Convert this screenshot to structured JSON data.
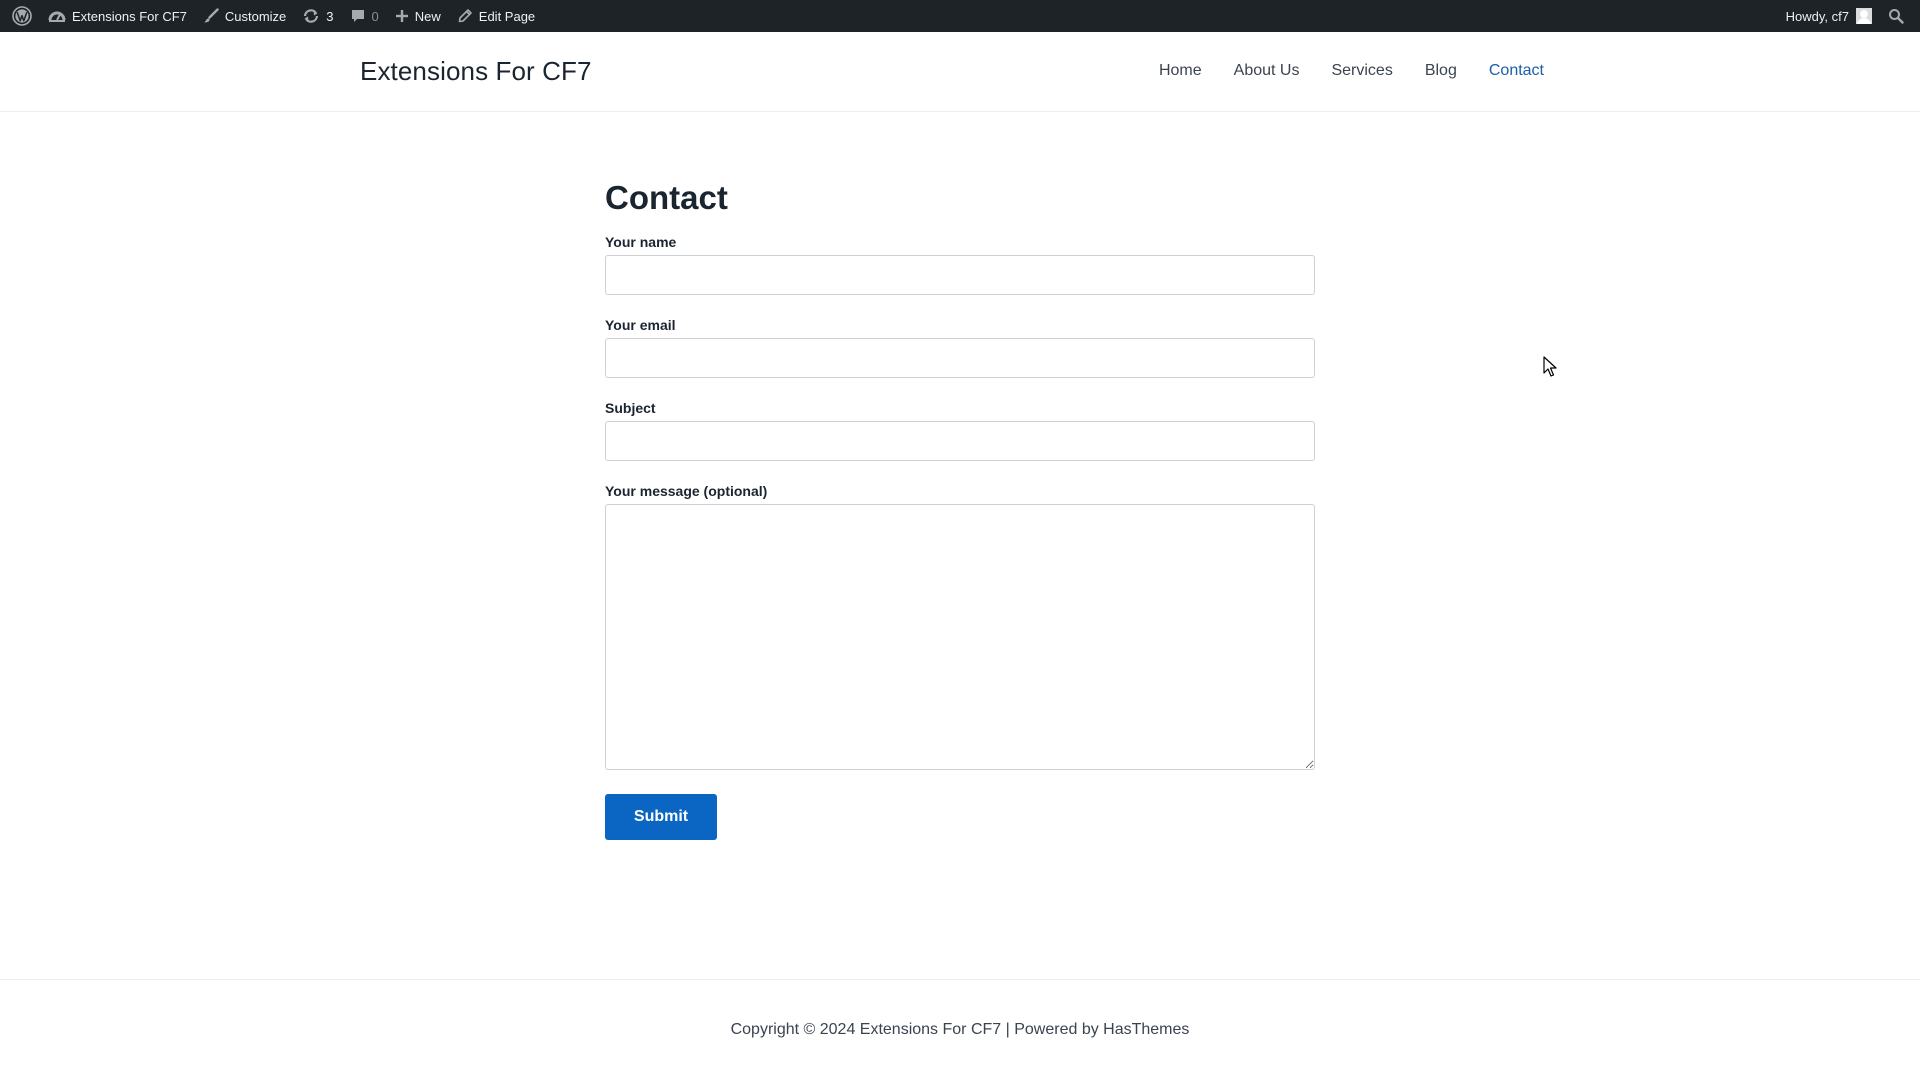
{
  "admin_bar": {
    "site_name": "Extensions For CF7",
    "customize_label": "Customize",
    "updates_count": "3",
    "comments_count": "0",
    "new_label": "New",
    "edit_label": "Edit Page",
    "greeting": "Howdy, cf7"
  },
  "header": {
    "site_title": "Extensions For CF7",
    "nav": [
      {
        "label": "Home"
      },
      {
        "label": "About Us"
      },
      {
        "label": "Services"
      },
      {
        "label": "Blog"
      },
      {
        "label": "Contact",
        "active": true
      }
    ]
  },
  "form": {
    "title": "Contact",
    "name_label": "Your name",
    "name_value": "",
    "email_label": "Your email",
    "email_value": "",
    "subject_label": "Subject",
    "subject_value": "",
    "message_label": "Your message (optional)",
    "message_value": "",
    "submit_label": "Submit"
  },
  "footer": {
    "copyright": "Copyright © 2024 Extensions For CF7 | Powered by HasThemes"
  },
  "colors": {
    "admin_bar_bg": "#1d2327",
    "accent": "#0a66c2",
    "active_nav": "#1a5fa8"
  }
}
